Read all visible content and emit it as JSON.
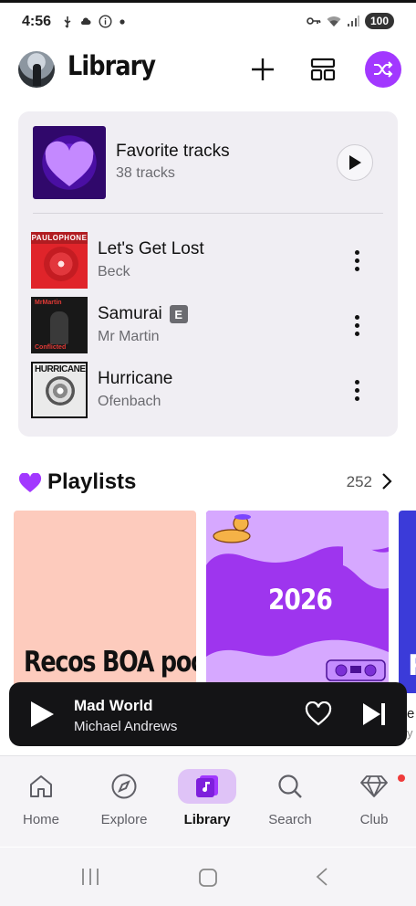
{
  "status_bar": {
    "time": "4:56",
    "battery": "100",
    "icons": [
      "usb-icon",
      "cloud-icon",
      "info-icon",
      "dot-icon",
      "vpn-key-icon",
      "wifi-icon",
      "signal-icon"
    ]
  },
  "header": {
    "title": "Library",
    "actions": [
      "add-icon",
      "layout-icon",
      "shuffle-icon"
    ]
  },
  "favorites": {
    "title": "Favorite tracks",
    "subtitle": "38 tracks",
    "tracks": [
      {
        "title": "Let's Get Lost",
        "artist": "Beck",
        "explicit": false,
        "cover_text": "PAULOPHONE"
      },
      {
        "title": "Samurai",
        "artist": "Mr Martin",
        "explicit": true,
        "explicit_label": "E",
        "cover_text": "MrMartin",
        "cover_text_2": "Conflicted"
      },
      {
        "title": "Hurricane",
        "artist": "Ofenbach",
        "explicit": false,
        "cover_text": "HURRICANE"
      }
    ]
  },
  "playlists": {
    "title": "Playlists",
    "count": "252",
    "items": [
      {
        "label": "Recos BOA pool",
        "color": "#fdcbbd"
      },
      {
        "label": "2026",
        "color": "#9e35ee"
      },
      {
        "label": "R",
        "color": "#3b3bd9"
      }
    ]
  },
  "mini_player": {
    "title": "Mad World",
    "artist": "Michael Andrews",
    "peek_title": "e",
    "peek_artist": "y"
  },
  "bottom_nav": {
    "items": [
      {
        "label": "Home",
        "icon": "home-icon",
        "active": false
      },
      {
        "label": "Explore",
        "icon": "compass-icon",
        "active": false
      },
      {
        "label": "Library",
        "icon": "library-icon",
        "active": true
      },
      {
        "label": "Search",
        "icon": "search-icon",
        "active": false
      },
      {
        "label": "Club",
        "icon": "diamond-icon",
        "active": false,
        "badge": true
      }
    ]
  },
  "colors": {
    "accent": "#a238ff",
    "card_bg": "#f0eef3",
    "mini_player_bg": "#141416",
    "active_nav_pill": "#dfc3f7"
  }
}
